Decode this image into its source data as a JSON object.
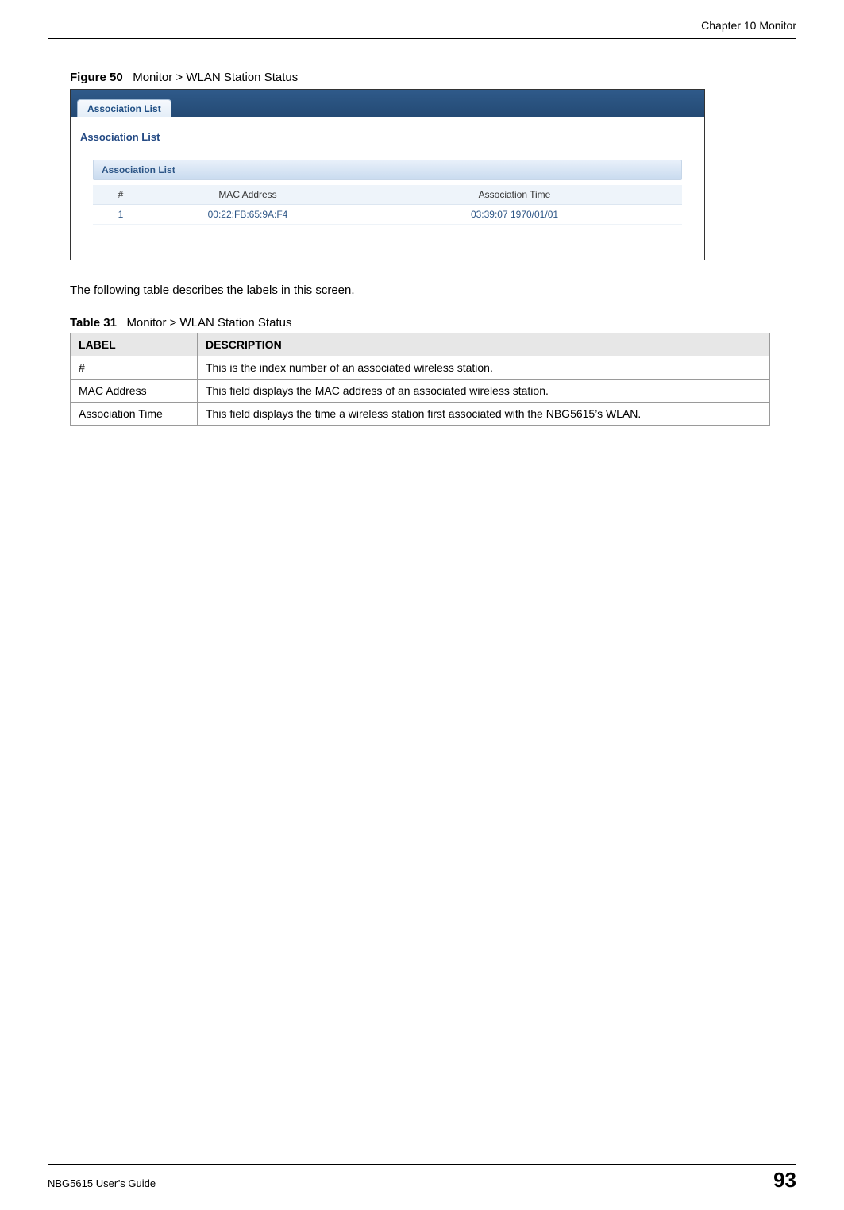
{
  "header": {
    "chapter": "Chapter 10 Monitor"
  },
  "figure": {
    "label": "Figure 50",
    "title": "Monitor > WLAN Station Status"
  },
  "screenshot": {
    "tab_label": "Association List",
    "section_title": "Association List",
    "panel_title": "Association List",
    "columns": {
      "index": "#",
      "mac": "MAC Address",
      "time": "Association Time"
    },
    "rows": [
      {
        "index": "1",
        "mac": "00:22:FB:65:9A:F4",
        "time": "03:39:07 1970/01/01"
      }
    ]
  },
  "body_text": "The following table describes the labels in this screen.",
  "table": {
    "label": "Table 31",
    "title": "Monitor > WLAN Station Status",
    "header_label": "LABEL",
    "header_desc": "DESCRIPTION",
    "rows": [
      {
        "label": "#",
        "desc": "This is the index number of an associated wireless station."
      },
      {
        "label": "MAC Address",
        "desc": "This field displays the MAC address of an associated wireless station."
      },
      {
        "label": "Association Time",
        "desc": "This field displays the time a wireless station first associated with the NBG5615’s WLAN."
      }
    ]
  },
  "footer": {
    "guide": "NBG5615 User’s Guide",
    "page": "93"
  }
}
